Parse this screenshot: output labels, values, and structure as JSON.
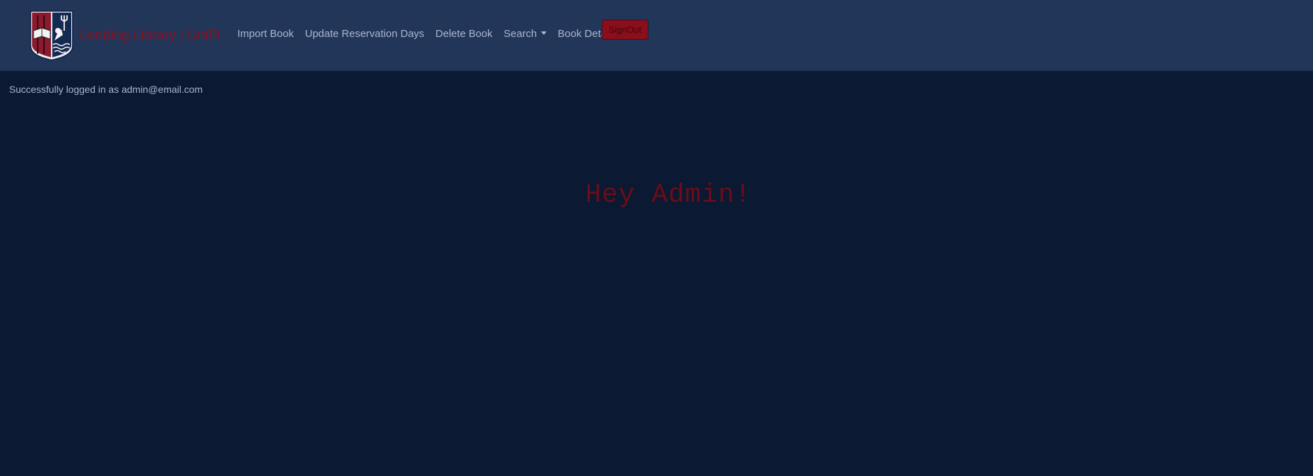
{
  "brand": {
    "title": "Lending Library | UniPi",
    "logo_icon": "university-crest-icon",
    "accent_color": "#8b0e1a"
  },
  "nav": {
    "items": [
      {
        "label": "Import Book"
      },
      {
        "label": "Update Reservation Days"
      },
      {
        "label": "Delete Book"
      },
      {
        "label": "Search",
        "dropdown": true
      },
      {
        "label": "Book Details"
      }
    ],
    "signout_label": "SignOut"
  },
  "status": {
    "message": "Successfully logged in as admin@email.com"
  },
  "main": {
    "greeting": "Hey Admin!"
  },
  "colors": {
    "navbar_bg": "#22365a",
    "page_bg": "#0b1932",
    "link_color": "#a9b7cc"
  }
}
